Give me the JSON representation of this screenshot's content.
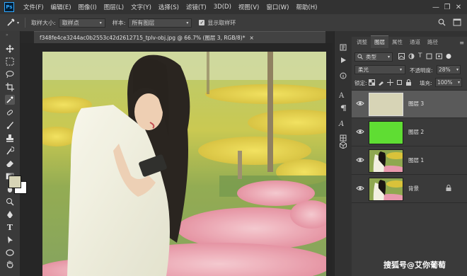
{
  "menu": {
    "app_badge": "Ps",
    "items": [
      "文件(F)",
      "编辑(E)",
      "图像(I)",
      "图层(L)",
      "文字(Y)",
      "选择(S)",
      "滤镜(T)",
      "3D(D)",
      "视图(V)",
      "窗口(W)",
      "帮助(H)"
    ],
    "window_controls": [
      "—",
      "❐",
      "✕"
    ]
  },
  "options_bar": {
    "sample_size_label": "取样大小:",
    "sample_size_value": "取样点",
    "sample_label": "样本:",
    "sample_value": "所有图层",
    "show_ring_label": "显示取样环"
  },
  "document": {
    "tab_title": "f348fe4ce3244ac0b2553c42d2612715_tplv-obj.jpg @ 66.7% (图层 3, RGB/8)*",
    "close_glyph": "×"
  },
  "colors": {
    "foreground": "#d7d4b6",
    "background": "#ffffff",
    "accent_green": "#5fdd33"
  },
  "layers_panel": {
    "tabs": [
      "调整",
      "图层",
      "属性",
      "通道",
      "路径"
    ],
    "active_tab": "图层",
    "filter_kind": "类型",
    "blend_mode": "柔光",
    "opacity_label": "不透明度:",
    "opacity_value": "28%",
    "lock_label": "锁定:",
    "fill_label": "填充:",
    "fill_value": "100%",
    "layers": [
      {
        "name": "图层 3",
        "thumb": "solid",
        "color": "#d7d4b6",
        "selected": true
      },
      {
        "name": "图层 2",
        "thumb": "solid",
        "color": "#5fdd33",
        "selected": false
      },
      {
        "name": "图层 1",
        "thumb": "photo",
        "selected": false
      },
      {
        "name": "背景",
        "thumb": "photo",
        "selected": false,
        "locked": true
      }
    ]
  },
  "watermark": "搜狐号@艾你葡萄"
}
